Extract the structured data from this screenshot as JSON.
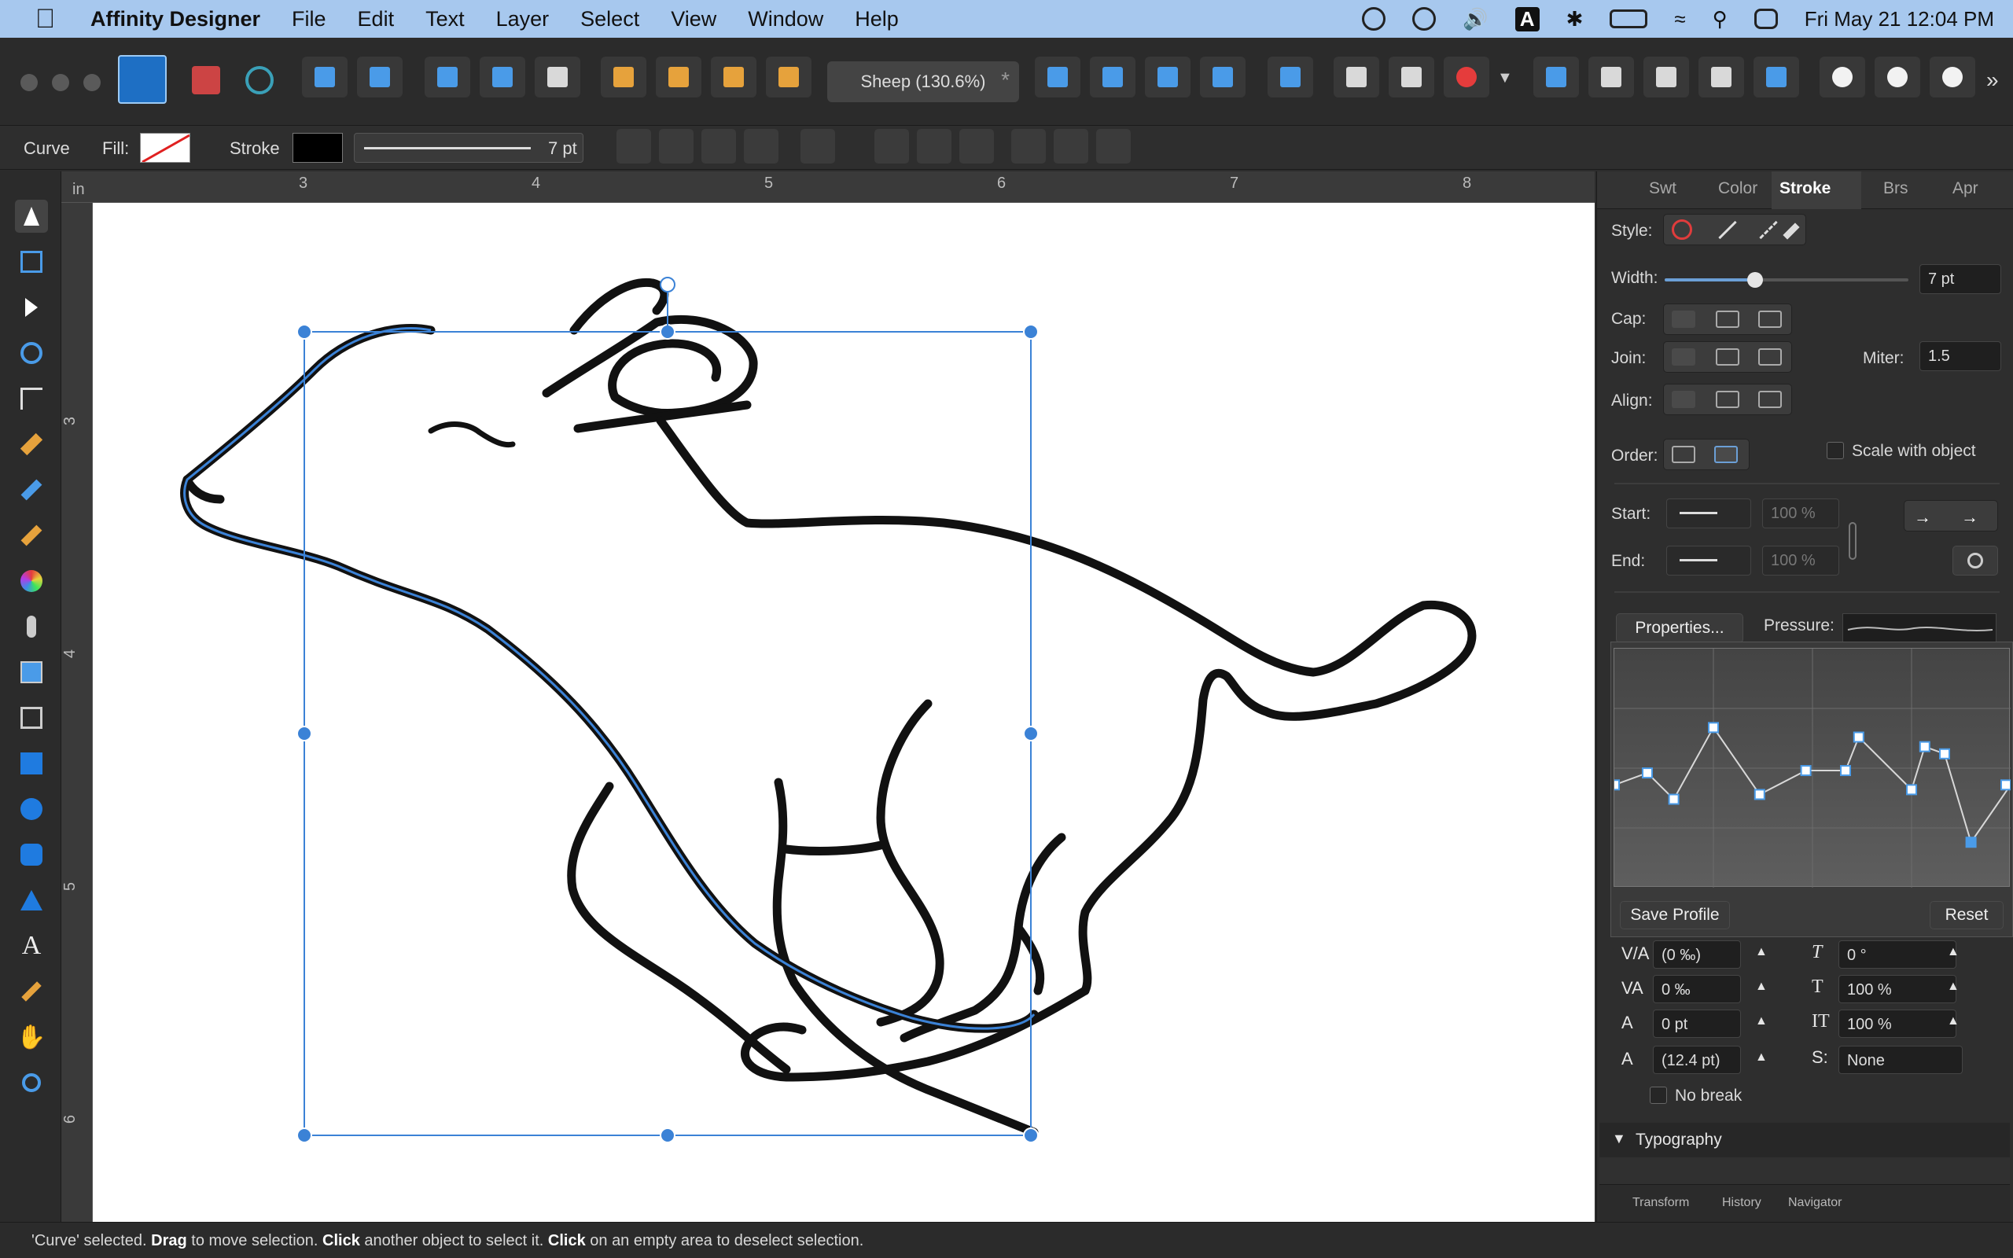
{
  "menubar": {
    "app_name": "Affinity Designer",
    "items": [
      "File",
      "Edit",
      "Text",
      "Layer",
      "Select",
      "View",
      "Window",
      "Help"
    ],
    "clock": "Fri May 21  12:04 PM",
    "input_source": "A"
  },
  "toolbar": {
    "document_tab": "Sheep (130.6%)",
    "document_modified_mark": "*"
  },
  "context": {
    "object_type": "Curve",
    "fill_label": "Fill:",
    "stroke_label": "Stroke",
    "stroke_width": "7 pt"
  },
  "ruler": {
    "unit": "in",
    "h_ticks": [
      "3",
      "4",
      "5",
      "6",
      "7",
      "8"
    ],
    "v_ticks": [
      "3",
      "4",
      "5",
      "6"
    ]
  },
  "panel": {
    "tabs": [
      "Swt",
      "Color",
      "Stroke",
      "Brs",
      "Apr"
    ],
    "active_tab": "Stroke",
    "style_label": "Style:",
    "width_label": "Width:",
    "width_value": "7 pt",
    "width_slider": 0.37,
    "cap_label": "Cap:",
    "join_label": "Join:",
    "miter_label": "Miter:",
    "miter_value": "1.5",
    "align_label": "Align:",
    "order_label": "Order:",
    "scale_with_object": "Scale with object",
    "start_label": "Start:",
    "start_pct": "100 %",
    "end_label": "End:",
    "end_pct": "100 %",
    "properties_button": "Properties...",
    "pressure_label": "Pressure:",
    "save_profile": "Save Profile",
    "reset": "Reset",
    "pressure_points": [
      [
        0.0,
        0.57
      ],
      [
        0.05,
        0.52
      ],
      [
        0.09,
        0.63
      ],
      [
        0.15,
        0.33
      ],
      [
        0.22,
        0.61
      ],
      [
        0.29,
        0.51
      ],
      [
        0.35,
        0.51
      ],
      [
        0.37,
        0.37
      ],
      [
        0.45,
        0.59
      ],
      [
        0.47,
        0.41
      ],
      [
        0.5,
        0.44
      ],
      [
        0.54,
        0.81
      ],
      [
        0.6,
        0.57
      ]
    ],
    "char": {
      "r1_left": "(0 ‰)",
      "r1_right": "0 °",
      "r2_left": "0 ‰",
      "r2_right": "100 %",
      "r3_left": "0 pt",
      "r3_right": "100 %",
      "r4_left": "(12.4 pt)",
      "r4_right": "None",
      "no_break": "No break"
    },
    "typography": "Typography",
    "bottom_tabs": [
      "Transform",
      "History",
      "Navigator"
    ]
  },
  "status": {
    "p1": "'Curve' selected. ",
    "b1": "Drag",
    "p2": " to move selection. ",
    "b2": "Click",
    "p3": " another object to select it. ",
    "b3": "Click",
    "p4": " on an empty area to deselect selection."
  },
  "colors": {
    "selection": "#3b82d6",
    "menubar_bg": "#a7c8ee"
  }
}
